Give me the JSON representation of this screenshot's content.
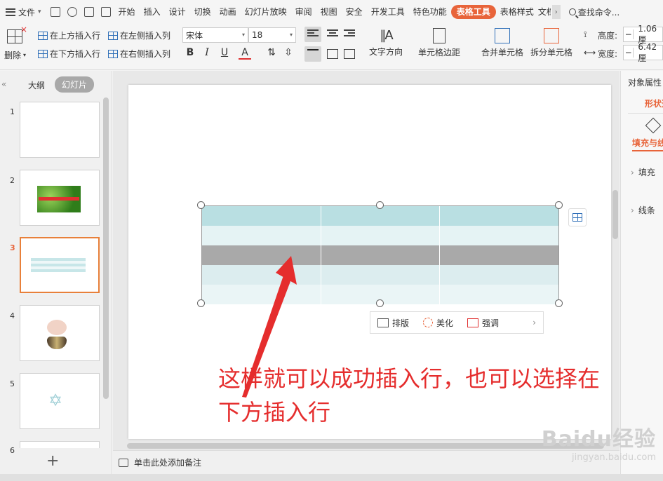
{
  "menubar": {
    "file_label": "文件",
    "tabs": [
      "开始",
      "插入",
      "设计",
      "切换",
      "动画",
      "幻灯片放映",
      "审阅",
      "视图",
      "安全",
      "开发工具",
      "特色功能",
      "表格工具",
      "表格样式",
      "文档"
    ],
    "active_tab": "表格工具",
    "search": "查找命令..."
  },
  "ribbon": {
    "delete": "删除",
    "insert_above": "在上方插入行",
    "insert_below": "在下方插入行",
    "insert_left": "在左侧插入列",
    "insert_right": "在右侧插入列",
    "font": "宋体",
    "size": "18",
    "bold": "B",
    "italic": "I",
    "underline": "U",
    "font_color": "A",
    "text_direction": "文字方向",
    "cell_margin": "单元格边距",
    "merge": "合并单元格",
    "split": "拆分单元格",
    "height_label": "高度:",
    "height_value": "1.06厘",
    "width_label": "宽度:",
    "width_value": "6.42厘"
  },
  "leftpanel": {
    "outline": "大纲",
    "slides": "幻灯片",
    "thumb_numbers": [
      "1",
      "2",
      "3",
      "4",
      "5",
      "6"
    ],
    "current": "3"
  },
  "canvas": {
    "ctx_bar": [
      "排版",
      "美化",
      "强调"
    ],
    "annotation_line1": "这样就可以成功插入行，也可以选择在",
    "annotation_line2": "下方插入行"
  },
  "notes": {
    "placeholder": "单击此处添加备注"
  },
  "rightpanel": {
    "title": "对象属性",
    "tab": "形状选项",
    "sub": "填充与线条",
    "fill": "填充",
    "line": "线条"
  },
  "watermark": {
    "main": "Baidu经验",
    "sub": "jingyan.baidu.com"
  },
  "colors": {
    "accent": "#e8643a",
    "annotation": "#e52d2d",
    "table_header": "#b9dfe2",
    "selected_row": "#a9a9a9"
  }
}
